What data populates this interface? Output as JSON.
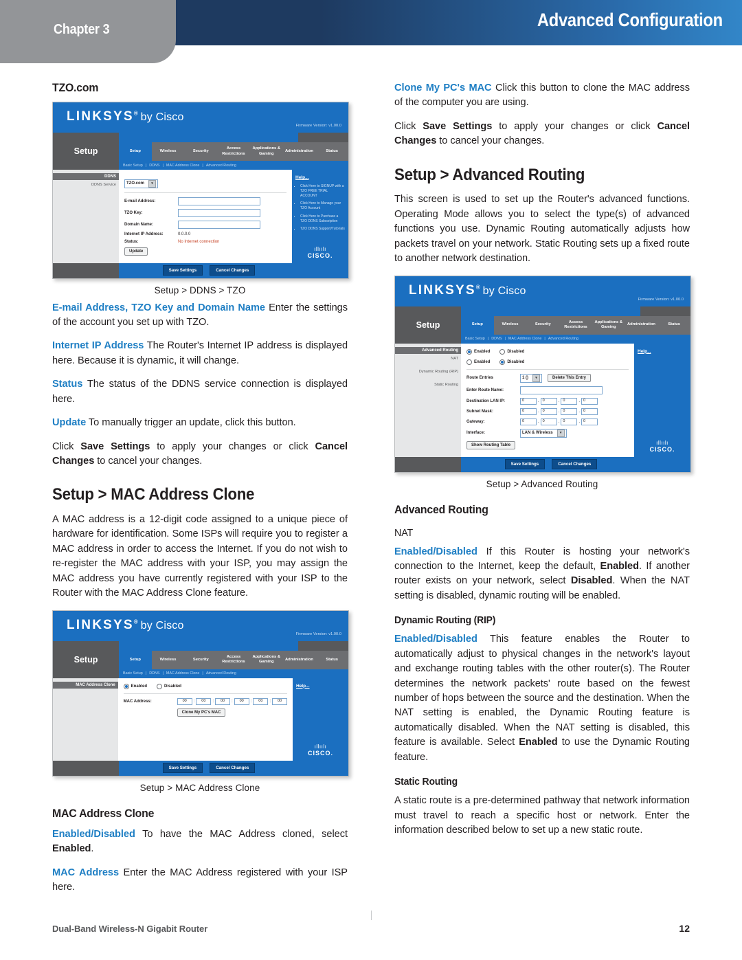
{
  "header": {
    "chapter_label": "Chapter 3",
    "banner_title": "Advanced Configuration",
    "banner_color_left": "#1e3a60",
    "banner_color_right": "#3286c8",
    "chapter_tab_color": "#939598"
  },
  "accent_color": "#1f7fc4",
  "left_column": {
    "tzo_heading": "TZO.com",
    "figure_tzo": {
      "caption": "Setup > DDNS > TZO",
      "ui": {
        "logo": "LINKSYS",
        "logo_sup": "®",
        "logo_suffix": "by Cisco",
        "firmware": "Firmware Version: v1.00.0",
        "page_name": "Setup",
        "tabs": [
          "Setup",
          "Wireless",
          "Security",
          "Access Restrictions",
          "Applications & Gaming",
          "Administration",
          "Status"
        ],
        "active_tab": "Setup",
        "subtabs": [
          "Basic Setup",
          "DDNS",
          "MAC Address Clone",
          "Advanced Routing"
        ],
        "side_header": "DDNS",
        "side_items": [
          "DDNS Service"
        ],
        "service_select": "TZO.com",
        "fields": [
          {
            "label": "E-mail Address:",
            "value": ""
          },
          {
            "label": "TZO Key:",
            "value": ""
          },
          {
            "label": "Domain Name:",
            "value": ""
          }
        ],
        "internet_ip_label": "Internet IP Address:",
        "internet_ip_value": "0.0.0.0",
        "status_label": "Status:",
        "status_value": "No Internet connection",
        "update_button": "Update",
        "help_title": "Help...",
        "help_items": [
          "Click Here to SIGNUP with a TZO FREE TRIAL ACCOUNT",
          "Click Here to Manage your TZO Account",
          "Click Here to Purchase a TZO DDNS Subscription",
          "TZO DDNS Support/Tutorials"
        ],
        "save_button": "Save Settings",
        "cancel_button": "Cancel Changes",
        "cisco_word": "CISCO."
      }
    },
    "para_email": {
      "run_in": "E-mail Address, TZO Key and Domain Name",
      "text": " Enter the settings of the account you set up with TZO."
    },
    "para_internet_ip": {
      "run_in": "Internet IP Address",
      "text": " The Router's Internet IP address is displayed here. Because it is dynamic, it will change."
    },
    "para_status": {
      "run_in": "Status",
      "text": " The status of the DDNS service connection is displayed here."
    },
    "para_update": {
      "run_in": "Update",
      "text": "  To manually trigger an update, click this button."
    },
    "para_save": {
      "p1": "Click ",
      "b1": "Save Settings",
      "p2": " to apply your changes or click ",
      "b2": "Cancel Changes",
      "p3": " to cancel your changes."
    },
    "mac_clone_heading": "Setup > MAC Address Clone",
    "mac_clone_intro": "A MAC address is a 12-digit code assigned to a unique piece of hardware for identification. Some ISPs will require you to register a MAC address in order to access the Internet. If you do not wish to re-register the MAC address with your ISP, you may assign the MAC address you have currently registered with your ISP to the Router with the MAC Address Clone feature.",
    "figure_mac": {
      "caption": "Setup > MAC Address Clone",
      "ui": {
        "logo": "LINKSYS",
        "logo_sup": "®",
        "logo_suffix": "by Cisco",
        "firmware": "Firmware Version: v1.00.0",
        "page_name": "Setup",
        "tabs": [
          "Setup",
          "Wireless",
          "Security",
          "Access Restrictions",
          "Applications & Gaming",
          "Administration",
          "Status"
        ],
        "active_tab": "Setup",
        "subtabs": [
          "Basic Setup",
          "DDNS",
          "MAC Address Clone",
          "Advanced Routing"
        ],
        "side_header": "MAC Address Clone",
        "radio_enabled": "Enabled",
        "radio_disabled": "Disabled",
        "selected_radio": "Enabled",
        "mac_label": "MAC Address:",
        "mac_octets": [
          "00",
          "00",
          "00",
          "00",
          "00",
          "00"
        ],
        "clone_button": "Clone My PC's MAC",
        "help_title": "Help...",
        "save_button": "Save Settings",
        "cancel_button": "Cancel Changes",
        "cisco_word": "CISCO."
      }
    },
    "mac_clone_sub_heading": "MAC Address Clone",
    "para_enabled_disabled": {
      "run_in": "Enabled/Disabled",
      "p1": " To have the MAC Address cloned, select ",
      "b1": "Enabled",
      "p2": "."
    },
    "para_mac_address": {
      "run_in": "MAC Address",
      "text": " Enter the MAC Address registered with your ISP here."
    }
  },
  "right_column": {
    "para_clone_my_pc": {
      "run_in": "Clone My PC's MAC",
      "text": "  Click this button to clone the MAC address of the computer you are using."
    },
    "para_save": {
      "p1": "Click ",
      "b1": "Save Settings",
      "p2": " to apply your changes or click ",
      "b2": "Cancel Changes",
      "p3": " to cancel your changes."
    },
    "adv_routing_heading": "Setup > Advanced Routing",
    "adv_routing_intro": "This screen is used to set up the Router's advanced functions. Operating Mode allows you to select the type(s) of advanced functions you use. Dynamic Routing automatically adjusts how packets travel on your network. Static Routing sets up a fixed route to another network destination.",
    "figure_routing": {
      "caption": "Setup > Advanced Routing",
      "ui": {
        "logo": "LINKSYS",
        "logo_sup": "®",
        "logo_suffix": "by Cisco",
        "firmware": "Firmware Version: v1.00.0",
        "page_name": "Setup",
        "tabs": [
          "Setup",
          "Wireless",
          "Security",
          "Access Restrictions",
          "Applications & Gaming",
          "Administration",
          "Status"
        ],
        "active_tab": "Setup",
        "subtabs": [
          "Basic Setup",
          "DDNS",
          "MAC Address Clone",
          "Advanced Routing"
        ],
        "side_header": "Advanced Routing",
        "side_items": [
          "NAT",
          "Dynamic Routing (RIP)",
          "Static Routing"
        ],
        "nat_enabled": "Enabled",
        "nat_disabled": "Disabled",
        "nat_selected": "Enabled",
        "rip_enabled": "Enabled",
        "rip_disabled": "Disabled",
        "rip_selected": "Disabled",
        "route_entries_label": "Route Entries",
        "route_entries_value": "1 ()",
        "delete_button": "Delete This Entry",
        "route_name_label": "Enter Route Name:",
        "route_name_value": "",
        "dest_lan_ip_label": "Destination LAN IP:",
        "dest_lan_ip": [
          "0",
          "0",
          "0",
          "0"
        ],
        "subnet_mask_label": "Subnet Mask:",
        "subnet_mask": [
          "0",
          "0",
          "0",
          "0"
        ],
        "gateway_label": "Gateway:",
        "gateway": [
          "0",
          "0",
          "0",
          "0"
        ],
        "interface_label": "Interface:",
        "interface_value": "LAN & Wireless",
        "show_routing_button": "Show Routing Table",
        "help_title": "Help...",
        "save_button": "Save Settings",
        "cancel_button": "Cancel Changes",
        "cisco_word": "CISCO."
      }
    },
    "adv_routing_sub_heading": "Advanced Routing",
    "nat_heading": "NAT",
    "para_nat": {
      "run_in": "Enabled/Disabled",
      "p1": "  If this Router is hosting your network's connection to the Internet, keep the default, ",
      "b1": "Enabled",
      "p2": ". If another router exists on your network, select ",
      "b2": "Disabled",
      "p3": ". When the NAT setting is disabled, dynamic routing will be enabled."
    },
    "rip_heading": "Dynamic Routing (RIP)",
    "para_rip": {
      "run_in": "Enabled/Disabled",
      "p1": " This feature enables the Router to automatically adjust to physical changes in the network's layout and exchange routing tables with the other router(s). The Router determines the network packets' route based on the fewest number of hops between the source and the destination. When the NAT setting is enabled, the Dynamic Routing feature is automatically disabled. When the NAT setting is disabled, this feature is available. Select ",
      "b1": "Enabled",
      "p2": " to use the Dynamic Routing feature."
    },
    "static_routing_heading": "Static Routing",
    "para_static": "A static route is a pre-determined pathway that network information must travel to reach a specific host or network. Enter the information described below to set up a new static route."
  },
  "footer": {
    "product": "Dual-Band Wireless-N Gigabit Router",
    "page_number": "12"
  }
}
